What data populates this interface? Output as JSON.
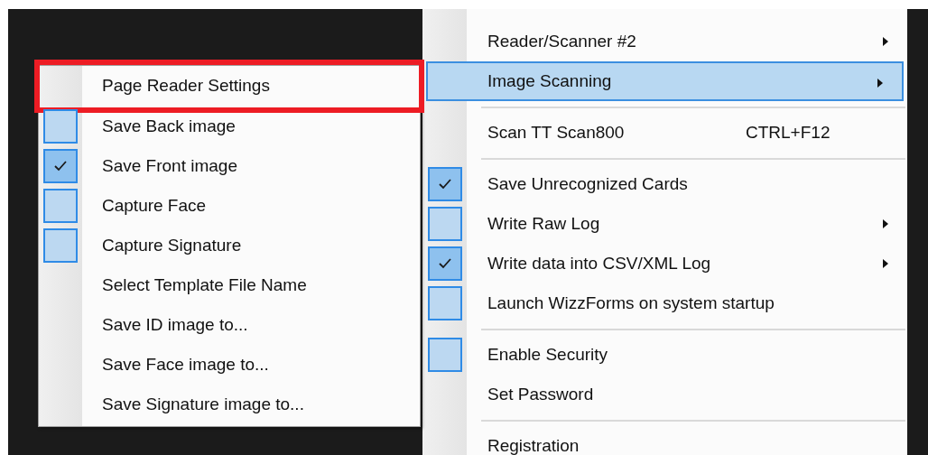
{
  "main_menu": {
    "items": [
      {
        "kind": "item",
        "label": "Reader/Scanner #2",
        "submenu": true,
        "selected": false
      },
      {
        "kind": "item",
        "label": "Image Scanning",
        "submenu": true,
        "selected": true
      },
      {
        "kind": "separator"
      },
      {
        "kind": "item",
        "label": "Scan TT Scan800",
        "shortcut": "CTRL+F12",
        "submenu": false,
        "selected": false
      },
      {
        "kind": "separator"
      },
      {
        "kind": "check",
        "label": "Save Unrecognized Cards",
        "checked": true,
        "submenu": false,
        "selected": false
      },
      {
        "kind": "check",
        "label": "Write Raw Log",
        "checked": false,
        "submenu": true,
        "selected": false
      },
      {
        "kind": "check",
        "label": "Write data into CSV/XML Log",
        "checked": true,
        "submenu": true,
        "selected": false
      },
      {
        "kind": "check",
        "label": "Launch WizzForms on system startup",
        "checked": false,
        "submenu": false,
        "selected": false
      },
      {
        "kind": "separator"
      },
      {
        "kind": "check",
        "label": "Enable Security",
        "checked": false,
        "submenu": false,
        "selected": false
      },
      {
        "kind": "item",
        "label": "Set Password",
        "submenu": false,
        "selected": false
      },
      {
        "kind": "separator"
      },
      {
        "kind": "item",
        "label": "Registration",
        "submenu": false,
        "selected": false
      }
    ]
  },
  "submenu": {
    "items": [
      {
        "kind": "item",
        "label": "Page Reader Settings",
        "highlighted": true
      },
      {
        "kind": "check",
        "label": "Save Back image",
        "checked": false,
        "highlighted": false
      },
      {
        "kind": "check",
        "label": "Save Front image",
        "checked": true,
        "highlighted": false
      },
      {
        "kind": "check",
        "label": "Capture Face",
        "checked": false,
        "highlighted": false
      },
      {
        "kind": "check",
        "label": "Capture Signature",
        "checked": false,
        "highlighted": false
      },
      {
        "kind": "item",
        "label": "Select Template File Name",
        "highlighted": false
      },
      {
        "kind": "item",
        "label": "Save ID image to...",
        "highlighted": false
      },
      {
        "kind": "item",
        "label": "Save Face image to...",
        "highlighted": false
      },
      {
        "kind": "item",
        "label": "Save Signature image to...",
        "highlighted": false
      }
    ]
  }
}
